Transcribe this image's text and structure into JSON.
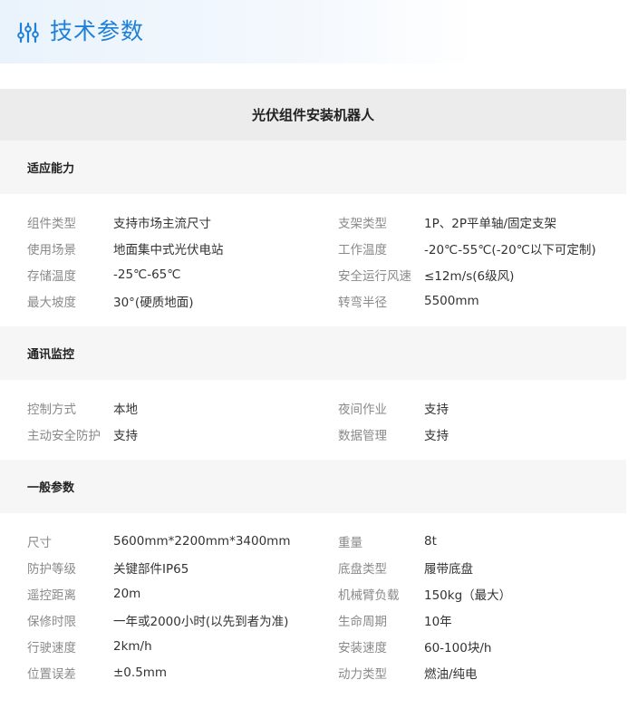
{
  "header": {
    "title": "技术参数",
    "icon": "sliders-icon",
    "accent": "#1e80d8"
  },
  "table": {
    "title": "光伏组件安装机器人"
  },
  "sections": [
    {
      "title": "适应能力",
      "rows": [
        {
          "left": {
            "label": "组件类型",
            "value": "支持市场主流尺寸"
          },
          "right": {
            "label": "支架类型",
            "value": "1P、2P平单轴/固定支架"
          }
        },
        {
          "left": {
            "label": "使用场景",
            "value": "地面集中式光伏电站"
          },
          "right": {
            "label": "工作温度",
            "value": "-20℃-55℃(-20℃以下可定制)"
          }
        },
        {
          "left": {
            "label": "存储温度",
            "value": "-25℃-65℃"
          },
          "right": {
            "label": "安全运行风速",
            "value": "≤12m/s(6级风)"
          }
        },
        {
          "left": {
            "label": "最大坡度",
            "value": "30°(硬质地面)"
          },
          "right": {
            "label": "转弯半径",
            "value": "5500mm"
          }
        }
      ]
    },
    {
      "title": "通讯监控",
      "rows": [
        {
          "left": {
            "label": "控制方式",
            "value": "本地"
          },
          "right": {
            "label": "夜间作业",
            "value": "支持"
          }
        },
        {
          "left": {
            "label": "主动安全防护",
            "value": "支持"
          },
          "right": {
            "label": "数据管理",
            "value": "支持"
          }
        }
      ]
    },
    {
      "title": "一般参数",
      "rows": [
        {
          "left": {
            "label": "尺寸",
            "value": "5600mm*2200mm*3400mm"
          },
          "right": {
            "label": "重量",
            "value": "8t"
          }
        },
        {
          "left": {
            "label": "防护等级",
            "value": "关键部件IP65"
          },
          "right": {
            "label": "底盘类型",
            "value": "履带底盘"
          }
        },
        {
          "left": {
            "label": "遥控距离",
            "value": "20m"
          },
          "right": {
            "label": "机械臂负载",
            "value": "150kg（最大）"
          }
        },
        {
          "left": {
            "label": "保修时限",
            "value": "一年或2000小时(以先到者为准)"
          },
          "right": {
            "label": "生命周期",
            "value": "10年"
          }
        },
        {
          "left": {
            "label": "行驶速度",
            "value": "2km/h"
          },
          "right": {
            "label": "安装速度",
            "value": "60-100块/h"
          }
        },
        {
          "left": {
            "label": "位置误差",
            "value": "±0.5mm"
          },
          "right": {
            "label": "动力类型",
            "value": "燃油/纯电"
          }
        }
      ]
    }
  ]
}
